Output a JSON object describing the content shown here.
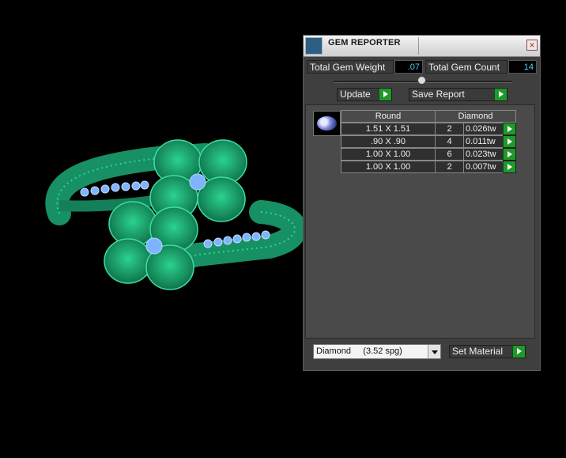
{
  "panel": {
    "title": "GEM REPORTER",
    "close_symbol": "×",
    "icon": "gem-reporter-icon"
  },
  "summary": {
    "total_weight_label": "Total Gem Weight",
    "total_weight_value": ".07",
    "total_count_label": "Total Gem Count",
    "total_count_value": "14"
  },
  "actions": {
    "update_label": "Update",
    "save_report_label": "Save Report"
  },
  "gem_table": {
    "shape_header": "Round",
    "material_header": "Diamond",
    "rows": [
      {
        "size": "1.51 X 1.51",
        "count": "2",
        "weight": "0.026tw"
      },
      {
        "size": ".90 X .90",
        "count": "4",
        "weight": "0.011tw"
      },
      {
        "size": "1.00 X 1.00",
        "count": "6",
        "weight": "0.023tw"
      },
      {
        "size": "1.00 X 1.00",
        "count": "2",
        "weight": "0.007tw"
      }
    ]
  },
  "material": {
    "selected": "Diamond     (3.52 spg)",
    "set_label": "Set Material"
  },
  "colors": {
    "ring_green": "#1faa72",
    "gem_blue": "#7db4ff",
    "panel_bg": "#3f3f3f",
    "value_text": "#4fd0ff",
    "go_green": "#1f9a2a"
  }
}
